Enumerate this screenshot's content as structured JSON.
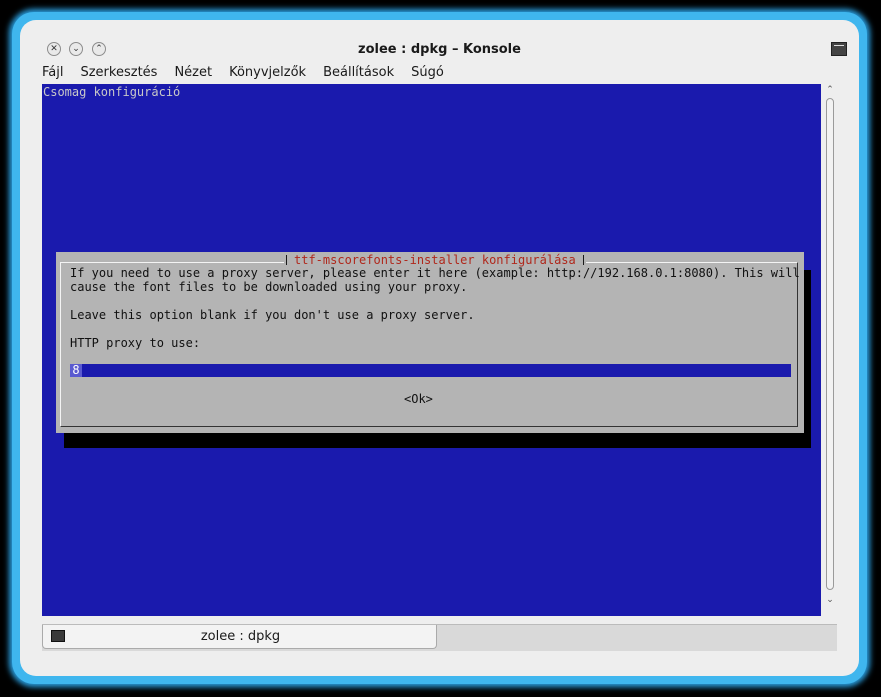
{
  "window": {
    "title": "zolee : dpkg – Konsole",
    "controls": {
      "close": "✕",
      "minimize": "⌄",
      "maximize": "⌃"
    }
  },
  "menu": [
    "Fájl",
    "Szerkesztés",
    "Nézet",
    "Könyvjelzők",
    "Beállítások",
    "Súgó"
  ],
  "terminal": {
    "header": "Csomag konfiguráció",
    "dialog": {
      "title": "ttf-mscorefonts-installer konfigurálása",
      "lines": [
        "If you need to use a proxy server, please enter it here (example: http://192.168.0.1:8080). This will",
        "cause the font files to be downloaded using your proxy.",
        "Leave this option blank if you don't use a proxy server.",
        "HTTP proxy to use:"
      ],
      "input_value": "8",
      "ok_label": "<Ok>"
    }
  },
  "scrollbar": {
    "up": "⌃",
    "down": "⌄"
  },
  "tabs": [
    {
      "label": "zolee : dpkg"
    }
  ],
  "colors": {
    "terminal_bg": "#1a1aad",
    "dialog_bg": "#b4b4b4",
    "dialog_title": "#b0281c",
    "window_glow": "#3fb6ee"
  }
}
